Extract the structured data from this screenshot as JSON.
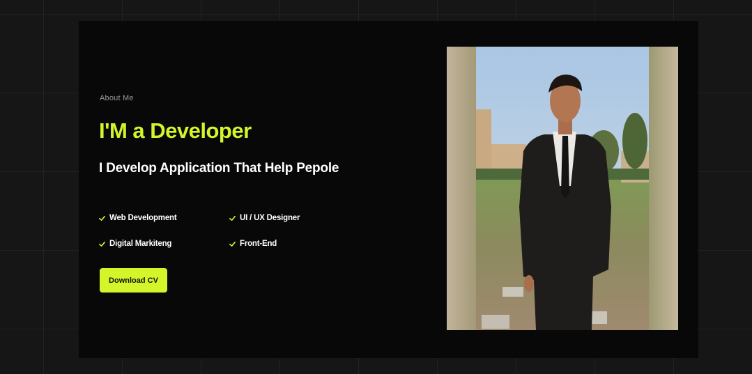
{
  "about": {
    "eyebrow": "About Me",
    "title": "I'M a Developer",
    "subtitle": "I Develop Application That Help Pepole"
  },
  "skills": [
    {
      "label": "Web Development",
      "icon": "check-icon"
    },
    {
      "label": "UI / UX Designer",
      "icon": "check-icon"
    },
    {
      "label": "Digital Markiteng",
      "icon": "check-icon"
    },
    {
      "label": "Front-End",
      "icon": "check-icon"
    }
  ],
  "cta": {
    "download_label": "Download CV"
  },
  "colors": {
    "accent": "#d4f52a",
    "background": "#161616",
    "card": "#080808",
    "text": "#ffffff",
    "muted": "#9a9a9a"
  }
}
